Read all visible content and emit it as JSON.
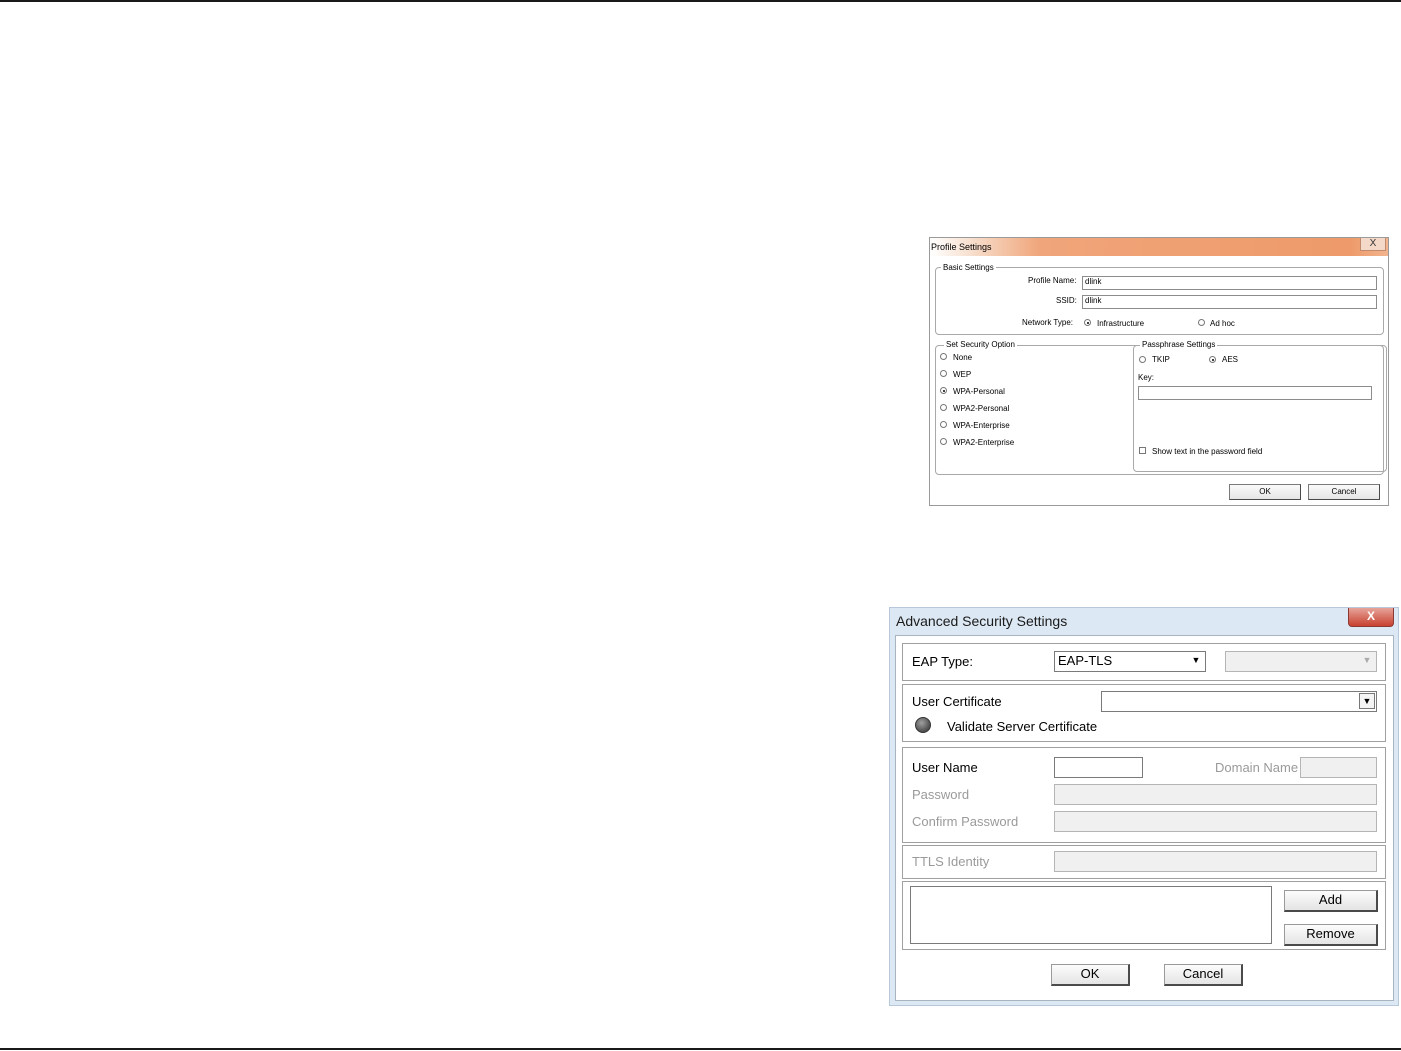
{
  "profile_settings": {
    "title": "Profile Settings",
    "close_glyph": "X",
    "basic": {
      "group_label": "Basic Settings",
      "profile_name_label": "Profile Name:",
      "profile_name_value": "dlink",
      "ssid_label": "SSID:",
      "ssid_value": "dlink",
      "network_type_label": "Network Type:",
      "infrastructure_label": "Infrastructure",
      "adhoc_label": "Ad hoc",
      "selected": "Infrastructure"
    },
    "security": {
      "group_label": "Set Security Option",
      "options": [
        "None",
        "WEP",
        "WPA-Personal",
        "WPA2-Personal",
        "WPA-Enterprise",
        "WPA2-Enterprise"
      ],
      "selected": "WPA-Personal"
    },
    "passphrase": {
      "group_label": "Passphrase Settings",
      "tkip_label": "TKIP",
      "aes_label": "AES",
      "selected": "AES",
      "key_label": "Key:",
      "key_value": "",
      "show_text_label": "Show text in the password field"
    },
    "ok_label": "OK",
    "cancel_label": "Cancel"
  },
  "advanced_security": {
    "title": "Advanced Security Settings",
    "close_glyph": "X",
    "eap_type_label": "EAP Type:",
    "eap_type_value": "EAP-TLS",
    "eap_subtype_value": "",
    "user_certificate_label": "User Certificate",
    "user_certificate_value": "",
    "validate_server_cert_label": "Validate Server Certificate",
    "user_name_label": "User Name",
    "user_name_value": "",
    "domain_name_label": "Domain Name",
    "domain_name_value": "",
    "password_label": "Password",
    "confirm_password_label": "Confirm Password",
    "ttls_identity_label": "TTLS Identity",
    "add_label": "Add",
    "remove_label": "Remove",
    "ok_label": "OK",
    "cancel_label": "Cancel"
  }
}
